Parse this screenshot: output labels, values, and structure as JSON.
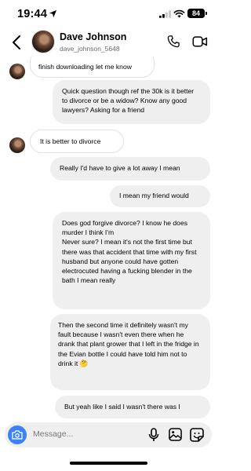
{
  "status_bar": {
    "time": "19:44",
    "battery": "84"
  },
  "header": {
    "name": "Dave Johnson",
    "handle": "dave_johnson_5648"
  },
  "messages": [
    {
      "side": "in",
      "text": "finish downloading let me know"
    },
    {
      "side": "out",
      "text": "Quick question though ref the 30k is it better to divorce or be a widow? Know any good lawyers? Asking for a friend"
    },
    {
      "side": "in",
      "text": "It is better to divorce"
    },
    {
      "side": "out",
      "text": "Really I'd have to give a lot away I mean"
    },
    {
      "side": "out",
      "text": "I mean my friend would"
    },
    {
      "side": "out",
      "text": "Does god forgive divorce? I know he does murder I think I'm\nNever sure? I mean it's not the first time but there was that accident that time with my first husband but anyone could have gotten electrocuted having a fucking blender in the bath I mean really"
    },
    {
      "side": "out",
      "text": "Then the second time it definitely wasn't my fault because I wasn't even there when he drank that plant grower that I left in the fridge in the Evian bottle I could have told him not to drink it 🤔"
    },
    {
      "side": "out",
      "text": "But yeah like I said I wasn't there was I"
    }
  ],
  "composer": {
    "placeholder": "Message..."
  }
}
